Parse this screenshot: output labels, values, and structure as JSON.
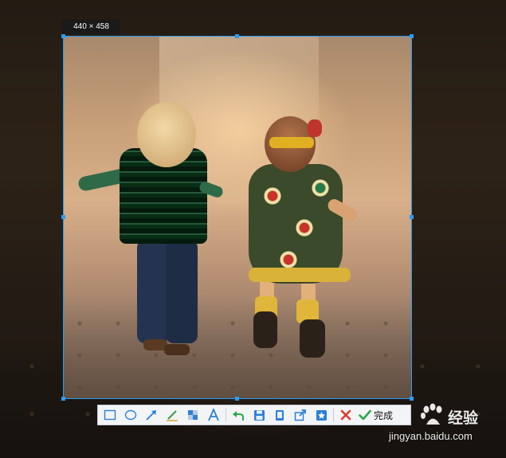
{
  "selection": {
    "size_label": "440 × 458"
  },
  "toolbar": {
    "tools": [
      {
        "name": "rectangle",
        "icon": "rectangle-icon"
      },
      {
        "name": "ellipse",
        "icon": "ellipse-icon"
      },
      {
        "name": "arrow",
        "icon": "arrow-icon"
      },
      {
        "name": "pen",
        "icon": "pen-icon"
      },
      {
        "name": "mosaic",
        "icon": "mosaic-icon"
      },
      {
        "name": "text",
        "icon": "text-icon"
      },
      {
        "name": "undo",
        "icon": "undo-icon"
      },
      {
        "name": "save",
        "icon": "save-icon"
      },
      {
        "name": "copy",
        "icon": "copy-icon"
      },
      {
        "name": "share",
        "icon": "share-icon"
      },
      {
        "name": "pin",
        "icon": "pin-icon"
      },
      {
        "name": "cancel",
        "icon": "close-icon"
      }
    ],
    "done_label": "完成",
    "accent_color": "#2d7fd6",
    "cancel_color": "#e03a2f",
    "done_color": "#2aa84a"
  },
  "watermark": {
    "brand": "经验",
    "url": "jingyan.baidu.com"
  },
  "colors": {
    "selection_border": "#2d9bf0"
  }
}
